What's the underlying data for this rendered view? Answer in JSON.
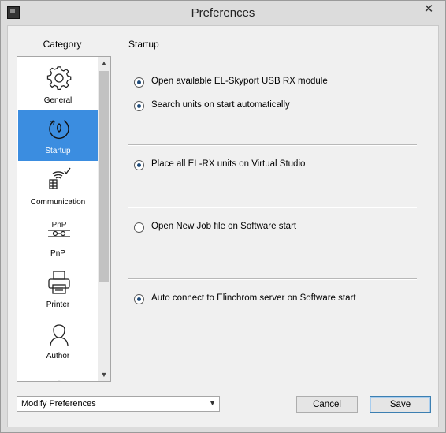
{
  "window": {
    "title": "Preferences",
    "close_glyph": "✕"
  },
  "sidebar": {
    "heading": "Category",
    "items": [
      {
        "label": "General",
        "icon": "gear-icon"
      },
      {
        "label": "Startup",
        "icon": "startup-power-icon",
        "selected": true
      },
      {
        "label": "Communication",
        "icon": "wireless-antenna-icon"
      },
      {
        "label": "PnP",
        "icon": "plug-and-play-icon"
      },
      {
        "label": "Printer",
        "icon": "printer-icon"
      },
      {
        "label": "Author",
        "icon": "user-icon"
      }
    ]
  },
  "main": {
    "section_title": "Startup",
    "options": [
      {
        "label": "Open available EL-Skyport USB RX module",
        "checked": true
      },
      {
        "label": "Search units on start automatically",
        "checked": true
      },
      {
        "label": "Place all EL-RX units on Virtual Studio",
        "checked": true
      },
      {
        "label": "Open New Job file on Software start",
        "checked": false
      },
      {
        "label": "Auto connect to Elinchrom server on Software start",
        "checked": true
      }
    ]
  },
  "footer": {
    "mode_select_value": "Modify Preferences",
    "cancel_label": "Cancel",
    "save_label": "Save"
  },
  "colors": {
    "selection": "#3b8de0",
    "window_bg": "#f0f0f0"
  }
}
